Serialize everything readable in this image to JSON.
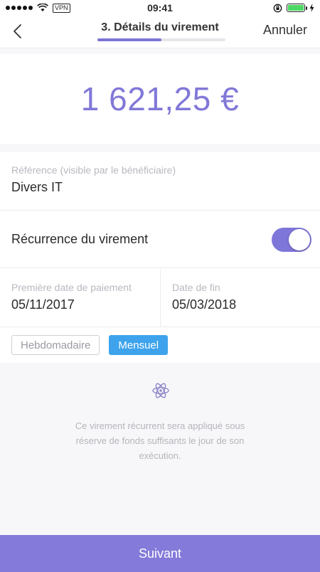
{
  "status_bar": {
    "carrier": "VPN",
    "time": "09:41",
    "battery_level": 1.0,
    "battery_color": "#4cd964"
  },
  "nav": {
    "title": "3. Détails du virement",
    "progress": 0.5,
    "cancel_label": "Annuler",
    "back_icon": "chevron-left-icon"
  },
  "amount": {
    "value": "1 621,25 €",
    "color": "#8178d8"
  },
  "form": {
    "reference": {
      "label": "Référence (visible par le bénéficiaire)",
      "value": "Divers IT"
    },
    "recurrence": {
      "label": "Récurrence du virement",
      "enabled": true
    },
    "first_date": {
      "label": "Première date de paiement",
      "value": "05/11/2017"
    },
    "end_date": {
      "label": "Date de fin",
      "value": "05/03/2018"
    },
    "frequency": {
      "options": [
        "Hebdomadaire",
        "Mensuel"
      ],
      "selected": "Mensuel"
    }
  },
  "info": {
    "icon": "atom-icon",
    "text": "Ce virement récurrent sera appliqué sous réserve de fonds suffisants le jour de son exécution."
  },
  "footer": {
    "next_label": "Suivant",
    "color": "#837ad9"
  }
}
